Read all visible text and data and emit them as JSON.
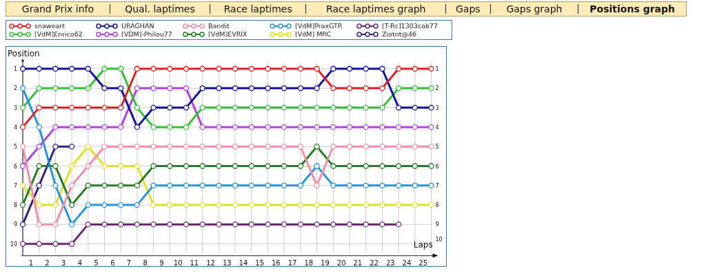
{
  "tabs": [
    {
      "label": "Grand Prix info",
      "selected": false
    },
    {
      "label": "Qual. laptimes",
      "selected": false
    },
    {
      "label": "Race laptimes",
      "selected": false
    },
    {
      "label": "Race laptimes graph",
      "selected": false
    },
    {
      "label": "Gaps",
      "selected": false
    },
    {
      "label": "Gaps graph",
      "selected": false
    },
    {
      "label": "Positions graph",
      "selected": true
    }
  ],
  "chart": {
    "right_labels": [
      "1",
      "2",
      "3",
      "4",
      "5",
      "6",
      "7",
      "8",
      "9",
      "10"
    ],
    "chart_data": {
      "type": "line",
      "ylabel": "Position",
      "xlabel": "Laps",
      "grid": true,
      "x": [
        0,
        1,
        2,
        3,
        4,
        5,
        6,
        7,
        8,
        9,
        10,
        11,
        12,
        13,
        14,
        15,
        16,
        17,
        18,
        19,
        20,
        21,
        22,
        23,
        24,
        25
      ],
      "xlim": [
        0,
        25
      ],
      "ylim": [
        10.5,
        0.5
      ],
      "xticks": [
        {
          "value": 0.5,
          "label": "1"
        },
        {
          "value": 1.5,
          "label": "2"
        },
        {
          "value": 2.5,
          "label": "3"
        },
        {
          "value": 3.5,
          "label": "4"
        },
        {
          "value": 4.5,
          "label": "5"
        },
        {
          "value": 5.5,
          "label": "6"
        },
        {
          "value": 6.5,
          "label": "7"
        },
        {
          "value": 7.5,
          "label": "8"
        },
        {
          "value": 8.5,
          "label": "9"
        },
        {
          "value": 9.5,
          "label": "10"
        },
        {
          "value": 10.5,
          "label": "11"
        },
        {
          "value": 11.5,
          "label": "12"
        },
        {
          "value": 12.5,
          "label": "13"
        },
        {
          "value": 13.5,
          "label": "14"
        },
        {
          "value": 14.5,
          "label": "15"
        },
        {
          "value": 15.5,
          "label": "16"
        },
        {
          "value": 16.5,
          "label": "17"
        },
        {
          "value": 17.5,
          "label": "18"
        },
        {
          "value": 18.5,
          "label": "19"
        },
        {
          "value": 19.5,
          "label": "20"
        },
        {
          "value": 20.5,
          "label": "21"
        },
        {
          "value": 21.5,
          "label": "22"
        },
        {
          "value": 22.5,
          "label": "23"
        },
        {
          "value": 23.5,
          "label": "24"
        },
        {
          "value": 24.5,
          "label": "25"
        }
      ],
      "yticks": [
        1,
        2,
        3,
        4,
        5,
        6,
        7,
        8,
        9,
        10
      ],
      "series": [
        {
          "name": "snaweart",
          "color": "#e02020",
          "marker": "circle",
          "values": [
            4,
            3,
            3,
            3,
            3,
            3,
            3,
            1,
            1,
            1,
            1,
            1,
            1,
            1,
            1,
            1,
            1,
            1,
            1,
            2,
            2,
            2,
            2,
            1,
            1,
            1
          ]
        },
        {
          "name": "URAGHAN",
          "color": "#1010a0",
          "marker": "circle",
          "values": [
            1,
            1,
            1,
            1,
            1,
            2,
            2,
            4,
            3,
            3,
            3,
            2,
            2,
            2,
            2,
            2,
            2,
            2,
            2,
            1,
            1,
            1,
            1,
            3,
            3,
            3
          ]
        },
        {
          "name": "Bandit",
          "color": "#f08ca8",
          "marker": "circle",
          "values": [
            5,
            9,
            9,
            7,
            6,
            5,
            5,
            5,
            5,
            5,
            5,
            5,
            5,
            5,
            5,
            5,
            5,
            5,
            7,
            5,
            5,
            5,
            5,
            5,
            5,
            5
          ]
        },
        {
          "name": "[VdM]PraxGTR",
          "color": "#2094e0",
          "marker": "circle",
          "values": [
            2,
            4,
            7,
            9,
            8,
            8,
            8,
            8,
            7,
            7,
            7,
            7,
            7,
            7,
            7,
            7,
            7,
            7,
            6,
            7,
            7,
            7,
            7,
            7,
            7,
            7
          ]
        },
        {
          "name": "[T-Rc]1303cab77",
          "color": "#702478",
          "marker": "circle",
          "values": [
            10,
            10,
            10,
            10,
            9,
            9,
            9,
            9,
            9,
            9,
            9,
            9,
            9,
            9,
            9,
            9,
            9,
            9,
            9,
            9,
            9,
            9,
            9,
            9,
            null,
            null
          ]
        },
        {
          "name": "[VdM]Enrico62",
          "color": "#30c030",
          "marker": "circle",
          "values": [
            3,
            2,
            2,
            2,
            2,
            1,
            1,
            3,
            4,
            4,
            4,
            3,
            3,
            3,
            3,
            3,
            3,
            3,
            3,
            3,
            3,
            3,
            3,
            2,
            2,
            2
          ]
        },
        {
          "name": "[VDM]-Philou77",
          "color": "#b040e0",
          "marker": "circle",
          "values": [
            6,
            5,
            4,
            4,
            4,
            4,
            4,
            2,
            2,
            2,
            2,
            4,
            4,
            4,
            4,
            4,
            4,
            4,
            4,
            4,
            4,
            4,
            4,
            4,
            4,
            4
          ]
        },
        {
          "name": "[VdM]EVRIX",
          "color": "#208020",
          "marker": "circle",
          "values": [
            8,
            6,
            6,
            8,
            7,
            7,
            7,
            7,
            6,
            6,
            6,
            6,
            6,
            6,
            6,
            6,
            6,
            6,
            5,
            6,
            6,
            6,
            6,
            6,
            6,
            6
          ]
        },
        {
          "name": "[VdM] MRC",
          "color": "#e0e020",
          "marker": "circle",
          "values": [
            7,
            8,
            8,
            6,
            5,
            6,
            6,
            6,
            8,
            8,
            8,
            8,
            8,
            8,
            8,
            8,
            8,
            8,
            8,
            8,
            8,
            8,
            8,
            8,
            8,
            8
          ]
        },
        {
          "name": "Ziotnt@46",
          "color": "#302080",
          "marker": "circle",
          "values": [
            9,
            7,
            5,
            5,
            null,
            null,
            null,
            null,
            null,
            null,
            null,
            null,
            null,
            null,
            null,
            null,
            null,
            null,
            null,
            null,
            null,
            null,
            null,
            null,
            null,
            null
          ]
        }
      ]
    }
  }
}
